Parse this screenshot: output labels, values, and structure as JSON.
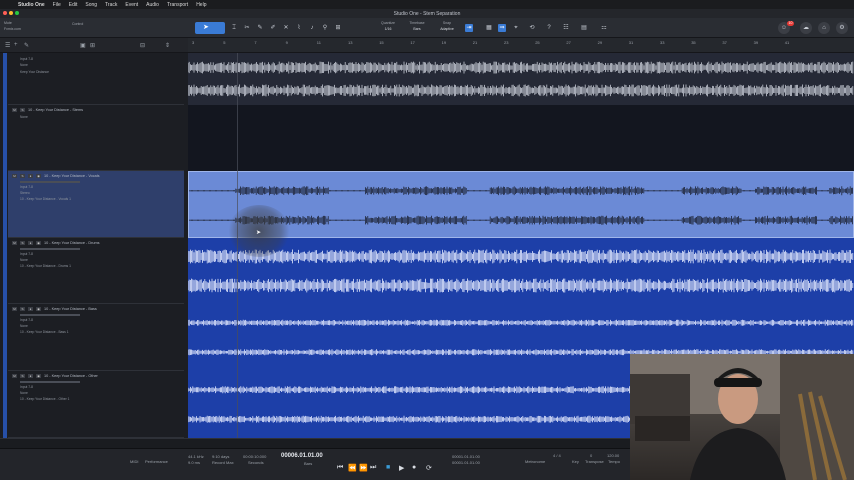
{
  "menubar": {
    "items": [
      "Studio One",
      "File",
      "Edit",
      "Song",
      "Track",
      "Event",
      "Audio",
      "Transport",
      "Help"
    ]
  },
  "titlebar": {
    "title": "Studio One - Stem Separation"
  },
  "toolbar": {
    "quantize_label": "Quantize",
    "quantize_value": "1/16",
    "timebase_label": "Timebase",
    "timebase_value": "Bars",
    "snap_label": "Snap",
    "snap_value": "Adaptive",
    "notif_count": "10",
    "control_label": "Control",
    "mute_label": "Mute",
    "fxmix_label": "Fxmix.com"
  },
  "ruler": {
    "bars": [
      "3",
      "5",
      "7",
      "9",
      "11",
      "13",
      "15",
      "17",
      "19",
      "21",
      "23",
      "25",
      "27",
      "29",
      "31",
      "33",
      "35",
      "37",
      "39",
      "41"
    ]
  },
  "tracks": [
    {
      "name": "Keep Your Distance",
      "input": "Input 7-8",
      "sub": "None",
      "selected": false
    },
    {
      "name": "10 - Keep Your Distance - Stems",
      "input": "",
      "sub": "None",
      "selected": false
    },
    {
      "name": "10 - Keep Your Distance - Vocals",
      "input": "Input 7-8",
      "sub": "Stereo",
      "out": "10 - Keep Your Distance - Vocals 1",
      "selected": true
    },
    {
      "name": "10 - Keep Your Distance - Drums",
      "input": "Input 7-8",
      "sub": "None",
      "out": "10 - Keep Your Distance - Drums 1",
      "selected": false
    },
    {
      "name": "10 - Keep Your Distance - Bass",
      "input": "Input 7-8",
      "sub": "None",
      "out": "10 - Keep Your Distance - Bass 1",
      "selected": false
    },
    {
      "name": "10 - Keep Your Distance - Other",
      "input": "Input 7-8",
      "sub": "None",
      "out": "10 - Keep Your Distance - Other 1",
      "selected": false
    }
  ],
  "transport": {
    "sample_rate": "44.1 kHz",
    "latency": "9.0 ms",
    "record_space": "9:10 days",
    "record_space_label": "Record Max",
    "time_seconds": "00:00:10.000",
    "time_label": "Seconds",
    "position": "00006.01.01.00",
    "position_label": "Bars",
    "loop_start": "00001.01.01.00",
    "loop_end": "00001.01.01.00",
    "signature": "4 / 4",
    "tempo": "120.00",
    "transpose": "0",
    "midi_label": "MIDI",
    "performance_label": "Performance",
    "metronome_label": "Metronome",
    "key_label": "Key",
    "transpose_label": "Transpose",
    "tempo_label": "Tempo"
  },
  "colors": {
    "accent": "#3a7bd5",
    "selected_lane": "#6f8ed8",
    "lane_blue": "#1d3fa8",
    "top_lane": "#2a2e3b"
  }
}
